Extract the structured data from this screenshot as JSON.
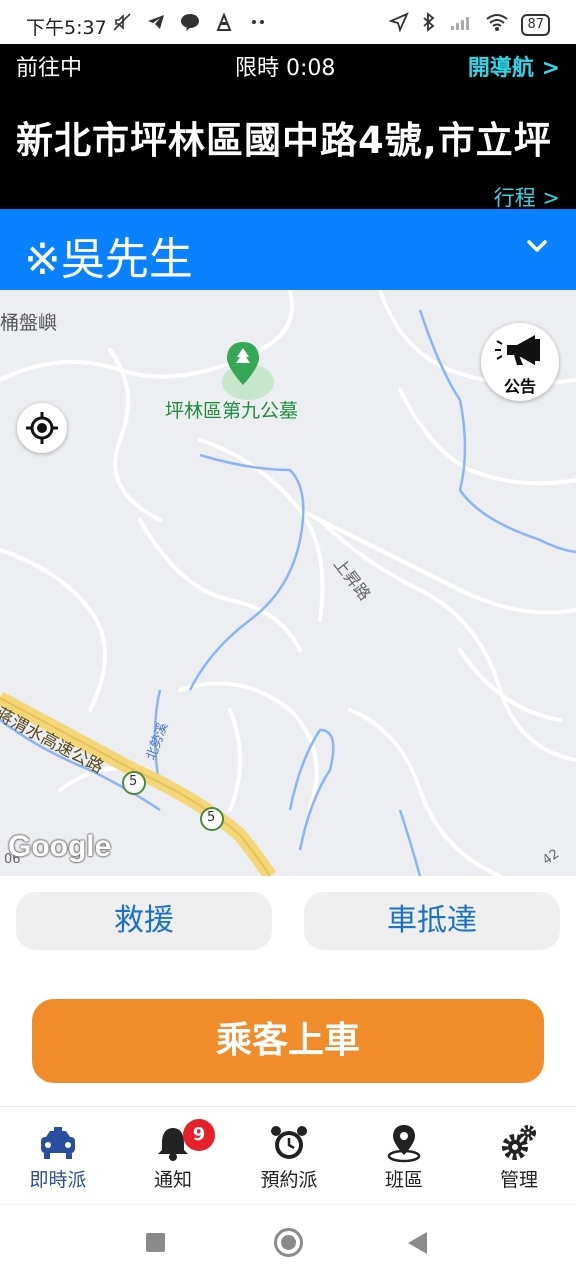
{
  "status_bar": {
    "time": "下午5:37",
    "left_icons": [
      "mute-icon",
      "telegram-icon",
      "line-icon",
      "app-icon",
      "more-dots-icon"
    ],
    "right_icons": [
      "location-arrow-icon",
      "bluetooth-icon",
      "signal-icon",
      "wifi-icon"
    ],
    "battery": "87"
  },
  "trip": {
    "status": "前往中",
    "timer": "限時 0:08",
    "nav_link": "開導航 >",
    "address": "新北市坪林區國中路4號,市立坪",
    "itinerary_link": "行程 >"
  },
  "passenger": {
    "name": "※吳先生"
  },
  "map": {
    "poi_label": "坪林區第九公墓",
    "place_label": "桶盤嶼",
    "road_label_1": "上昇路",
    "road_label_2": "蔣渭水高速公路",
    "stream_label": "北勢溪",
    "highway_shield_1": "5",
    "highway_shield_2": "5",
    "edge_label_left": "06",
    "edge_label_right": "42",
    "announce_label": "公告",
    "google_logo": "Google"
  },
  "actions": {
    "rescue": "救援",
    "arrived": "車抵達",
    "board": "乘客上車"
  },
  "tabs": [
    {
      "label": "即時派",
      "icon": "taxi-icon",
      "active": true
    },
    {
      "label": "通知",
      "icon": "bell-icon",
      "badge": "9"
    },
    {
      "label": "預約派",
      "icon": "alarm-clock-icon"
    },
    {
      "label": "班區",
      "icon": "location-pin-icon"
    },
    {
      "label": "管理",
      "icon": "gears-icon"
    }
  ],
  "colors": {
    "header_bg": "#000000",
    "accent_cyan": "#2fd6e6",
    "passenger_bar": "#0a82ff",
    "action_text": "#1a73c8",
    "board_button": "#f08c2a",
    "badge": "#e8202a",
    "poi_green": "#1e8e3e"
  }
}
